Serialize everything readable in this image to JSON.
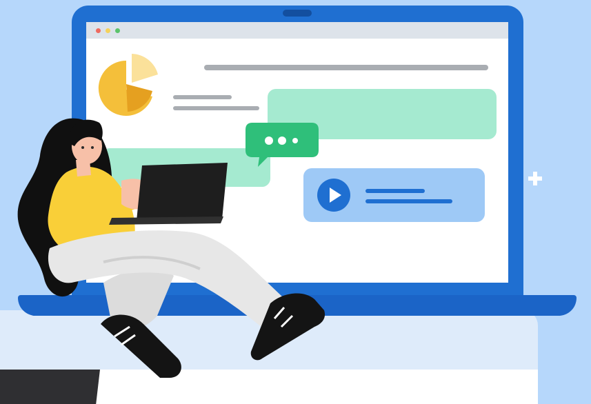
{
  "illustration": {
    "subject": "person-with-laptop",
    "icons": [
      "pie-chart-icon",
      "chat-bubble-icon",
      "play-icon",
      "sparkle-icon"
    ]
  },
  "colors": {
    "background": "#b6d7fb",
    "laptop_frame": "#1f6fd1",
    "accent_green": "#2fbf7a",
    "card_green": "#a5ead0",
    "card_blue": "#9ec9f6",
    "play_blue": "#1f6fd1",
    "pie_yellow": "#f4bf3a",
    "shirt_yellow": "#f9cf38"
  }
}
